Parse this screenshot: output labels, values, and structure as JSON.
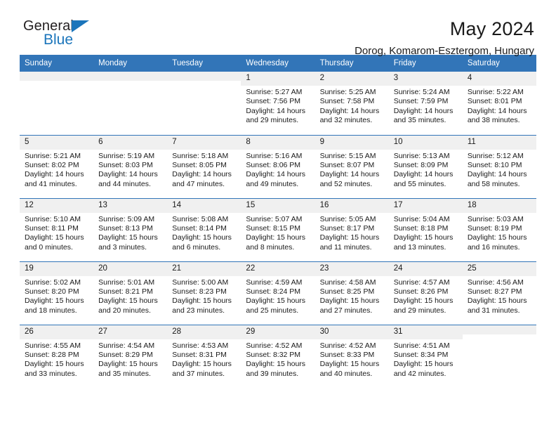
{
  "brand": {
    "name_top": "General",
    "name_bottom": "Blue",
    "accent_color": "#1b75bb"
  },
  "header": {
    "title": "May 2024",
    "subtitle": "Dorog, Komarom-Esztergom, Hungary"
  },
  "theme": {
    "header_bg": "#3275b8",
    "daynum_bg": "#f0f0f0",
    "text": "#1a1a1a"
  },
  "calendar": {
    "weekday_headers": [
      "Sunday",
      "Monday",
      "Tuesday",
      "Wednesday",
      "Thursday",
      "Friday",
      "Saturday"
    ],
    "weeks": [
      [
        {
          "day": "",
          "empty": true
        },
        {
          "day": "",
          "empty": true
        },
        {
          "day": "",
          "empty": true
        },
        {
          "day": "1",
          "sunrise": "Sunrise: 5:27 AM",
          "sunset": "Sunset: 7:56 PM",
          "daylight1": "Daylight: 14 hours",
          "daylight2": "and 29 minutes."
        },
        {
          "day": "2",
          "sunrise": "Sunrise: 5:25 AM",
          "sunset": "Sunset: 7:58 PM",
          "daylight1": "Daylight: 14 hours",
          "daylight2": "and 32 minutes."
        },
        {
          "day": "3",
          "sunrise": "Sunrise: 5:24 AM",
          "sunset": "Sunset: 7:59 PM",
          "daylight1": "Daylight: 14 hours",
          "daylight2": "and 35 minutes."
        },
        {
          "day": "4",
          "sunrise": "Sunrise: 5:22 AM",
          "sunset": "Sunset: 8:01 PM",
          "daylight1": "Daylight: 14 hours",
          "daylight2": "and 38 minutes."
        }
      ],
      [
        {
          "day": "5",
          "sunrise": "Sunrise: 5:21 AM",
          "sunset": "Sunset: 8:02 PM",
          "daylight1": "Daylight: 14 hours",
          "daylight2": "and 41 minutes."
        },
        {
          "day": "6",
          "sunrise": "Sunrise: 5:19 AM",
          "sunset": "Sunset: 8:03 PM",
          "daylight1": "Daylight: 14 hours",
          "daylight2": "and 44 minutes."
        },
        {
          "day": "7",
          "sunrise": "Sunrise: 5:18 AM",
          "sunset": "Sunset: 8:05 PM",
          "daylight1": "Daylight: 14 hours",
          "daylight2": "and 47 minutes."
        },
        {
          "day": "8",
          "sunrise": "Sunrise: 5:16 AM",
          "sunset": "Sunset: 8:06 PM",
          "daylight1": "Daylight: 14 hours",
          "daylight2": "and 49 minutes."
        },
        {
          "day": "9",
          "sunrise": "Sunrise: 5:15 AM",
          "sunset": "Sunset: 8:07 PM",
          "daylight1": "Daylight: 14 hours",
          "daylight2": "and 52 minutes."
        },
        {
          "day": "10",
          "sunrise": "Sunrise: 5:13 AM",
          "sunset": "Sunset: 8:09 PM",
          "daylight1": "Daylight: 14 hours",
          "daylight2": "and 55 minutes."
        },
        {
          "day": "11",
          "sunrise": "Sunrise: 5:12 AM",
          "sunset": "Sunset: 8:10 PM",
          "daylight1": "Daylight: 14 hours",
          "daylight2": "and 58 minutes."
        }
      ],
      [
        {
          "day": "12",
          "sunrise": "Sunrise: 5:10 AM",
          "sunset": "Sunset: 8:11 PM",
          "daylight1": "Daylight: 15 hours",
          "daylight2": "and 0 minutes."
        },
        {
          "day": "13",
          "sunrise": "Sunrise: 5:09 AM",
          "sunset": "Sunset: 8:13 PM",
          "daylight1": "Daylight: 15 hours",
          "daylight2": "and 3 minutes."
        },
        {
          "day": "14",
          "sunrise": "Sunrise: 5:08 AM",
          "sunset": "Sunset: 8:14 PM",
          "daylight1": "Daylight: 15 hours",
          "daylight2": "and 6 minutes."
        },
        {
          "day": "15",
          "sunrise": "Sunrise: 5:07 AM",
          "sunset": "Sunset: 8:15 PM",
          "daylight1": "Daylight: 15 hours",
          "daylight2": "and 8 minutes."
        },
        {
          "day": "16",
          "sunrise": "Sunrise: 5:05 AM",
          "sunset": "Sunset: 8:17 PM",
          "daylight1": "Daylight: 15 hours",
          "daylight2": "and 11 minutes."
        },
        {
          "day": "17",
          "sunrise": "Sunrise: 5:04 AM",
          "sunset": "Sunset: 8:18 PM",
          "daylight1": "Daylight: 15 hours",
          "daylight2": "and 13 minutes."
        },
        {
          "day": "18",
          "sunrise": "Sunrise: 5:03 AM",
          "sunset": "Sunset: 8:19 PM",
          "daylight1": "Daylight: 15 hours",
          "daylight2": "and 16 minutes."
        }
      ],
      [
        {
          "day": "19",
          "sunrise": "Sunrise: 5:02 AM",
          "sunset": "Sunset: 8:20 PM",
          "daylight1": "Daylight: 15 hours",
          "daylight2": "and 18 minutes."
        },
        {
          "day": "20",
          "sunrise": "Sunrise: 5:01 AM",
          "sunset": "Sunset: 8:21 PM",
          "daylight1": "Daylight: 15 hours",
          "daylight2": "and 20 minutes."
        },
        {
          "day": "21",
          "sunrise": "Sunrise: 5:00 AM",
          "sunset": "Sunset: 8:23 PM",
          "daylight1": "Daylight: 15 hours",
          "daylight2": "and 23 minutes."
        },
        {
          "day": "22",
          "sunrise": "Sunrise: 4:59 AM",
          "sunset": "Sunset: 8:24 PM",
          "daylight1": "Daylight: 15 hours",
          "daylight2": "and 25 minutes."
        },
        {
          "day": "23",
          "sunrise": "Sunrise: 4:58 AM",
          "sunset": "Sunset: 8:25 PM",
          "daylight1": "Daylight: 15 hours",
          "daylight2": "and 27 minutes."
        },
        {
          "day": "24",
          "sunrise": "Sunrise: 4:57 AM",
          "sunset": "Sunset: 8:26 PM",
          "daylight1": "Daylight: 15 hours",
          "daylight2": "and 29 minutes."
        },
        {
          "day": "25",
          "sunrise": "Sunrise: 4:56 AM",
          "sunset": "Sunset: 8:27 PM",
          "daylight1": "Daylight: 15 hours",
          "daylight2": "and 31 minutes."
        }
      ],
      [
        {
          "day": "26",
          "sunrise": "Sunrise: 4:55 AM",
          "sunset": "Sunset: 8:28 PM",
          "daylight1": "Daylight: 15 hours",
          "daylight2": "and 33 minutes."
        },
        {
          "day": "27",
          "sunrise": "Sunrise: 4:54 AM",
          "sunset": "Sunset: 8:29 PM",
          "daylight1": "Daylight: 15 hours",
          "daylight2": "and 35 minutes."
        },
        {
          "day": "28",
          "sunrise": "Sunrise: 4:53 AM",
          "sunset": "Sunset: 8:31 PM",
          "daylight1": "Daylight: 15 hours",
          "daylight2": "and 37 minutes."
        },
        {
          "day": "29",
          "sunrise": "Sunrise: 4:52 AM",
          "sunset": "Sunset: 8:32 PM",
          "daylight1": "Daylight: 15 hours",
          "daylight2": "and 39 minutes."
        },
        {
          "day": "30",
          "sunrise": "Sunrise: 4:52 AM",
          "sunset": "Sunset: 8:33 PM",
          "daylight1": "Daylight: 15 hours",
          "daylight2": "and 40 minutes."
        },
        {
          "day": "31",
          "sunrise": "Sunrise: 4:51 AM",
          "sunset": "Sunset: 8:34 PM",
          "daylight1": "Daylight: 15 hours",
          "daylight2": "and 42 minutes."
        },
        {
          "day": "",
          "empty": true
        }
      ]
    ]
  }
}
